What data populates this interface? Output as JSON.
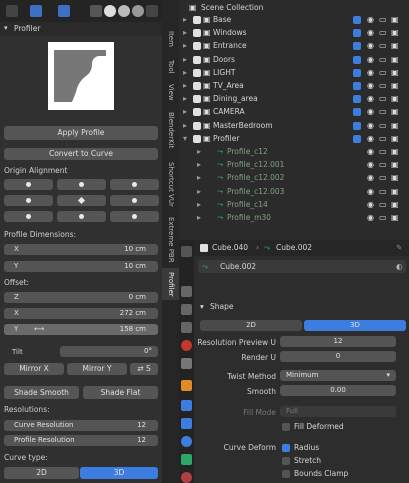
{
  "colors": {
    "accent": "#3d7de0",
    "panel": "#303030",
    "button": "#555555",
    "outliner_bg": "#2b2b2b"
  },
  "left_panel": {
    "title": "Profiler",
    "apply_profile": "Apply Profile",
    "convert_to_curve": "Convert to Curve",
    "origin_alignment": "Origin Alignment",
    "profile_dimensions": "Profile Dimensions:",
    "dims": [
      {
        "label": "X",
        "value": "10 cm"
      },
      {
        "label": "Y",
        "value": "10 cm"
      }
    ],
    "offset": "Offset:",
    "offsets": [
      {
        "label": "Z",
        "value": "0 cm"
      },
      {
        "label": "X",
        "value": "272 cm"
      },
      {
        "label": "Y",
        "value": "158 cm"
      }
    ],
    "tilt_label": "Tilt",
    "tilt_value": "0°",
    "mirror_x": "Mirror X",
    "mirror_y": "Mirror Y",
    "s_label": "S",
    "shade_smooth": "Shade Smooth",
    "shade_flat": "Shade Flat",
    "resolutions": "Resolutions:",
    "curve_resolution": {
      "label": "Curve Resolution",
      "value": "12"
    },
    "profile_resolution": {
      "label": "Profile Resolution",
      "value": "12"
    },
    "curve_type": "Curve type:",
    "type_2d": "2D",
    "type_3d": "3D"
  },
  "vertical_tabs": [
    "Item",
    "Tool",
    "View",
    "BlenderKit",
    "Shortcut VUr",
    "Extreme PBR",
    "Profiler"
  ],
  "outliner": {
    "root": "Scene Collection",
    "rows": [
      {
        "name": "Base",
        "level": 1
      },
      {
        "name": "Windows",
        "level": 1
      },
      {
        "name": "Entrance",
        "level": 1
      },
      {
        "name": "Doors",
        "level": 1
      },
      {
        "name": "LIGHT",
        "level": 1
      },
      {
        "name": "TV_Area",
        "level": 1
      },
      {
        "name": "Dining_area",
        "level": 1
      },
      {
        "name": "CAMERA",
        "level": 1
      },
      {
        "name": "MasterBedroom",
        "level": 1
      },
      {
        "name": "Profiler",
        "level": 1
      },
      {
        "name": "Profile_c12",
        "level": 2
      },
      {
        "name": "Profile_c12.001",
        "level": 2
      },
      {
        "name": "Profile_c12.002",
        "level": 2
      },
      {
        "name": "Profile_c12.003",
        "level": 2
      },
      {
        "name": "Profile_c14",
        "level": 2
      },
      {
        "name": "Profile_m30",
        "level": 2
      }
    ]
  },
  "properties": {
    "object_name": "Cube.040",
    "data_name": "Cube.002",
    "datablock": "Cube.002",
    "shape_header": "Shape",
    "btn_2d": "2D",
    "btn_3d": "3D",
    "resolution_preview_label": "Resolution Preview U",
    "resolution_preview_value": "12",
    "render_u_label": "Render U",
    "render_u_value": "0",
    "twist_method_label": "Twist Method",
    "twist_method_value": "Minimum",
    "smooth_label": "Smooth",
    "smooth_value": "0.00",
    "fill_mode_label": "Fill Mode",
    "fill_mode_value": "Full",
    "fill_deformed": "Fill Deformed",
    "curve_deform_label": "Curve Deform",
    "radius": "Radius",
    "stretch": "Stretch",
    "bounds_clamp": "Bounds Clamp"
  }
}
